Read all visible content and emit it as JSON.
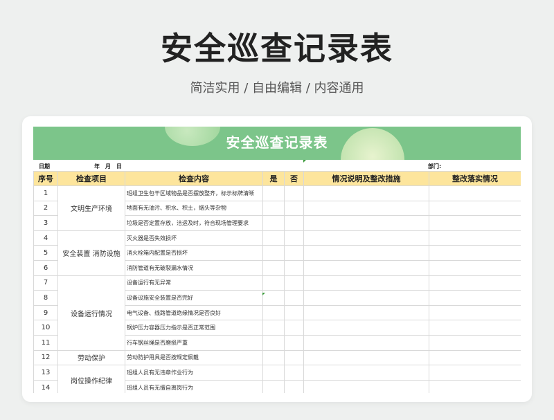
{
  "header": {
    "title": "安全巡查记录表",
    "subtitle": "简洁实用 / 自由编辑 / 内容通用"
  },
  "sheet": {
    "banner_title": "安全巡查记录表",
    "date_label": "日期",
    "year_month_day": "年　月　日",
    "dept_label": "部门:",
    "columns": {
      "seq": "序号",
      "item": "检查项目",
      "content": "检查内容",
      "yes": "是",
      "no": "否",
      "desc": "情况说明及整改措施",
      "impl": "整改落实情况"
    },
    "categories": {
      "c1": "文明生产环境",
      "c2": "安全装置 消防设施",
      "c3": "设备运行情况",
      "c4": "劳动保护",
      "c5": "岗位操作纪律"
    },
    "rows": [
      {
        "n": "1",
        "content": "班组卫生包干区域物品是否摆放整齐，标示标牌清晰"
      },
      {
        "n": "2",
        "content": "地面有无油污、积水、积土，烟头等杂物"
      },
      {
        "n": "3",
        "content": "垃圾是否定置存放，洁运及时，符合现场管理要求"
      },
      {
        "n": "4",
        "content": "灭火器是否失效损坏"
      },
      {
        "n": "5",
        "content": "消火栓箱内配置是否损坏"
      },
      {
        "n": "6",
        "content": "消防管道有无破裂漏水情况"
      },
      {
        "n": "7",
        "content": "设备运行有无异常"
      },
      {
        "n": "8",
        "content": "设备设施安全装置是否完好"
      },
      {
        "n": "9",
        "content": "电气设备、线路管道绝缘情况是否良好"
      },
      {
        "n": "10",
        "content": "锅炉压力容器压力指示是否正常范围"
      },
      {
        "n": "11",
        "content": "行车钢丝绳是否磨损严重"
      },
      {
        "n": "12",
        "content": "劳动防护用具是否按规定佩戴"
      },
      {
        "n": "13",
        "content": "班组人员有无违章作业行为"
      },
      {
        "n": "14",
        "content": "班组人员有无擅自离岗行为"
      }
    ]
  }
}
